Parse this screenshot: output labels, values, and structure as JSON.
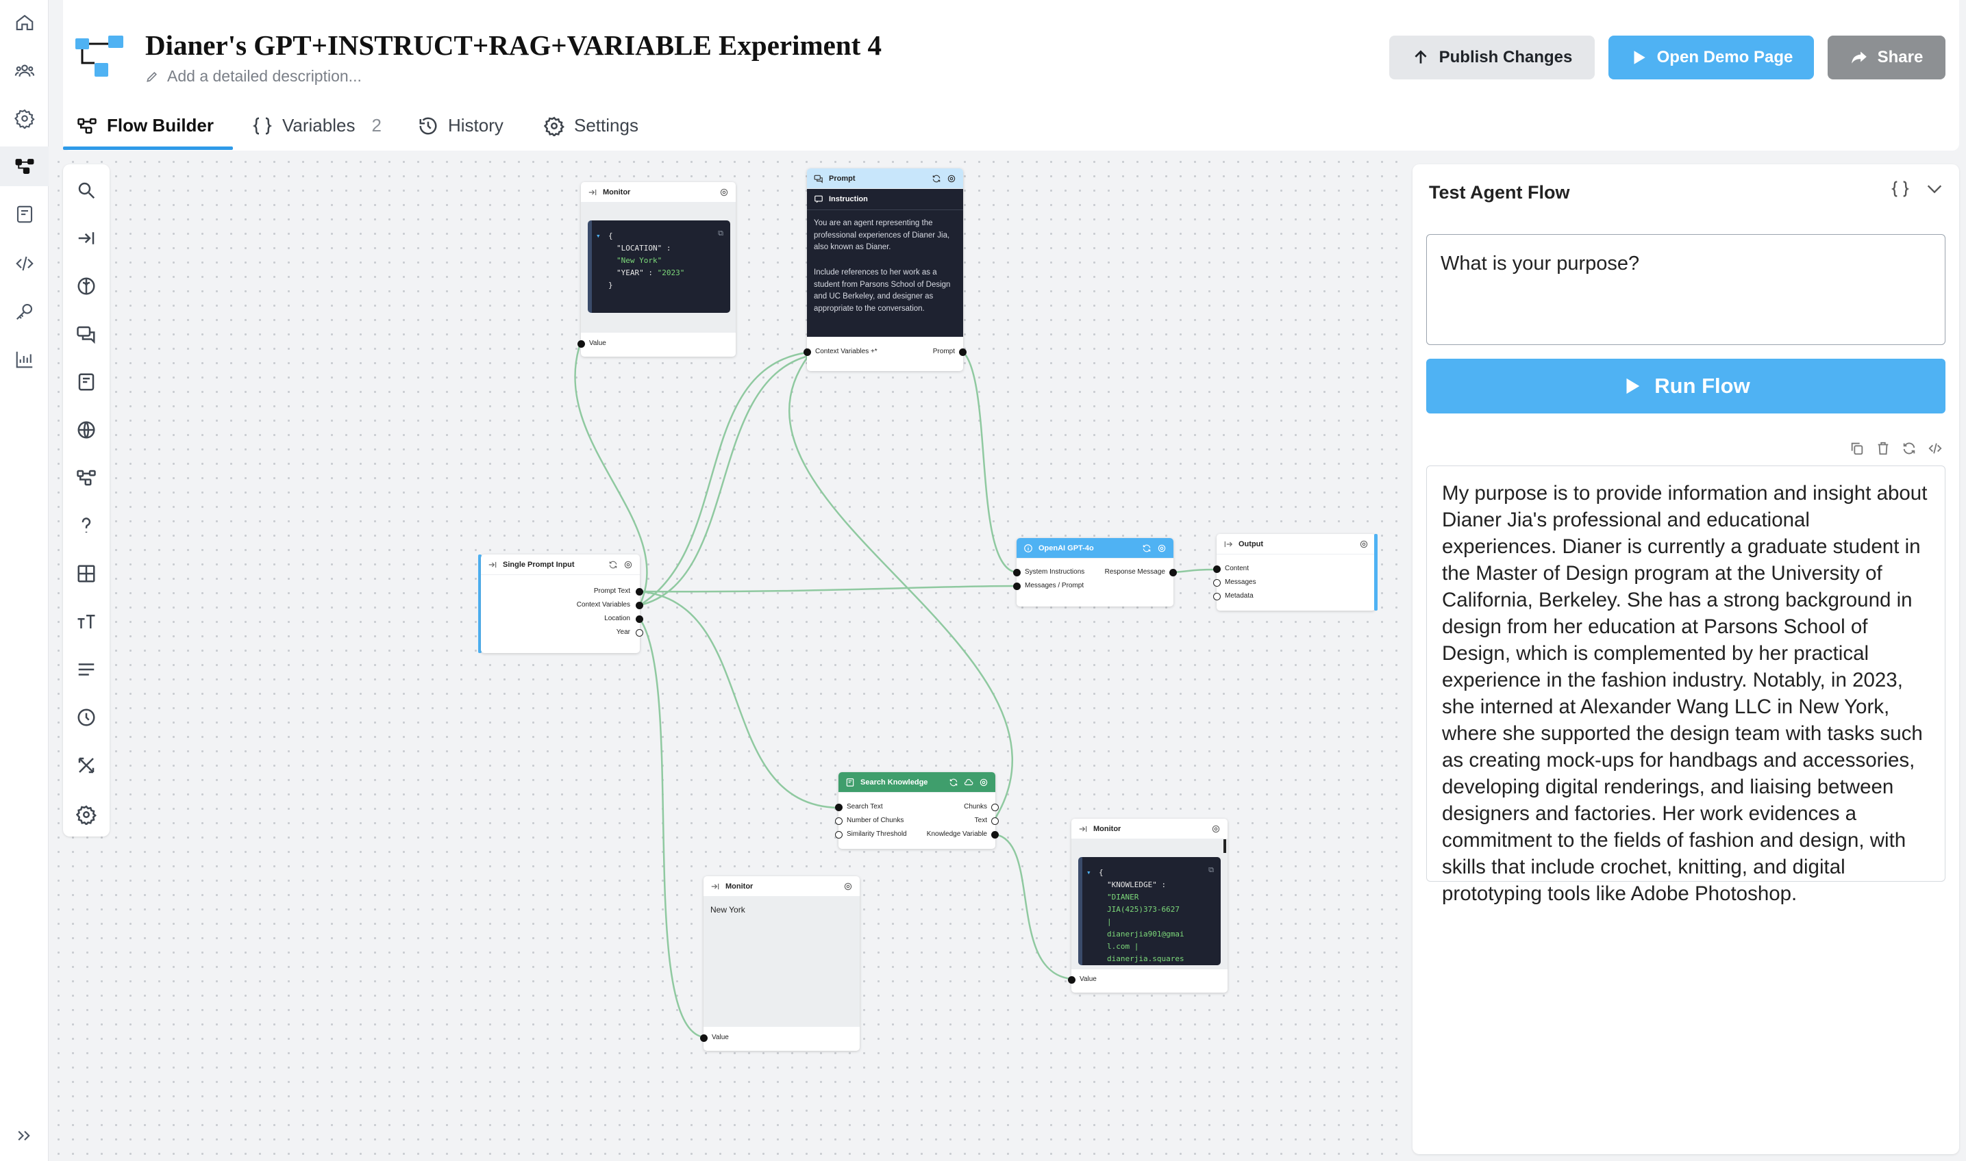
{
  "header": {
    "title": "Dianer's GPT+INSTRUCT+RAG+VARIABLE Experiment 4",
    "description_placeholder": "Add a detailed description...",
    "publish_label": "Publish Changes",
    "demo_label": "Open Demo Page",
    "share_label": "Share",
    "tabs": [
      {
        "label": "Flow Builder"
      },
      {
        "label": "Variables",
        "count": "2"
      },
      {
        "label": "History"
      },
      {
        "label": "Settings"
      }
    ]
  },
  "rail": {
    "icons": [
      "home-icon",
      "users-icon",
      "settings-icon",
      "flow-icon",
      "book-icon",
      "code-icon",
      "key-icon",
      "chart-icon",
      "expand-icon"
    ]
  },
  "palette": {
    "icons": [
      "search-icon",
      "input-icon",
      "brain-icon",
      "chat-icon",
      "book-icon",
      "globe-icon",
      "flow-icon",
      "question-icon",
      "grid-icon",
      "text-size-icon",
      "list-icon",
      "clock-icon",
      "shuffle-icon",
      "settings-icon"
    ]
  },
  "nodes": {
    "monitor_top": {
      "title": "Monitor",
      "code_lines": [
        {
          "k": "{",
          "v": ""
        },
        {
          "k": "\"LOCATION\" :",
          "v": ""
        },
        {
          "k": "",
          "v": "\"New York\""
        },
        {
          "k": "\"YEAR\" :",
          "v": "\"2023\""
        },
        {
          "k": "}",
          "v": ""
        }
      ],
      "port": "Value"
    },
    "prompt": {
      "title": "Prompt",
      "section": "Instruction",
      "para1": "You are an agent representing the professional experiences of Dianer Jia, also known as Dianer.",
      "para2": "Include references to her work as a student from Parsons School of Design and UC Berkeley, and designer as appropriate to the conversation.",
      "port_in": "Context Variables +*",
      "port_out": "Prompt"
    },
    "input": {
      "title": "Single Prompt Input",
      "ports": [
        "Prompt Text",
        "Context Variables",
        "Location",
        "Year"
      ]
    },
    "openai": {
      "title": "OpenAI GPT-4o",
      "ports_in": [
        "System Instructions",
        "Messages / Prompt"
      ],
      "port_out": "Response Message"
    },
    "output": {
      "title": "Output",
      "ports": [
        "Content",
        "Messages",
        "Metadata"
      ]
    },
    "search": {
      "title": "Search Knowledge",
      "ports_in": [
        "Search Text",
        "Number of Chunks",
        "Similarity Threshold"
      ],
      "ports_out": [
        "Chunks",
        "Text",
        "Knowledge Variable"
      ]
    },
    "monitor_mid": {
      "title": "Monitor",
      "text": "New York",
      "port": "Value"
    },
    "monitor_right": {
      "title": "Monitor",
      "code_lines": [
        {
          "k": "{",
          "v": ""
        },
        {
          "k": "\"KNOWLEDGE\" :",
          "v": ""
        },
        {
          "k": "",
          "v": "\"DIANER"
        },
        {
          "k": "",
          "v": "JIA(425)373-6627"
        },
        {
          "k": "",
          "v": "|"
        },
        {
          "k": "",
          "v": "dianerjia901@gmai"
        },
        {
          "k": "",
          "v": "l.com |"
        },
        {
          "k": "",
          "v": "dianerjia.squares"
        }
      ],
      "port": "Value"
    }
  },
  "panel": {
    "title": "Test Agent Flow",
    "prompt_value": "What is your purpose?",
    "run_label": "Run Flow",
    "answer": "My purpose is to provide information and insight about Dianer Jia's professional and educational experiences. Dianer is currently a graduate student in the Master of Design program at the University of California, Berkeley. She has a strong background in design from her education at Parsons School of Design, which is complemented by her practical experience in the fashion industry. Notably, in 2023, she interned at Alexander Wang LLC in New York, where she supported the design team with tasks such as creating mock-ups for handbags and accessories, developing digital renderings, and liaising between designers and factories. Her work evidences a commitment to the fields of fashion and design, with skills that include crochet, knitting, and digital prototyping tools like Adobe Photoshop."
  },
  "colors": {
    "accent": "#4fb2f3",
    "edge": "#8fc9a0",
    "search_header": "#3f9e6c"
  }
}
